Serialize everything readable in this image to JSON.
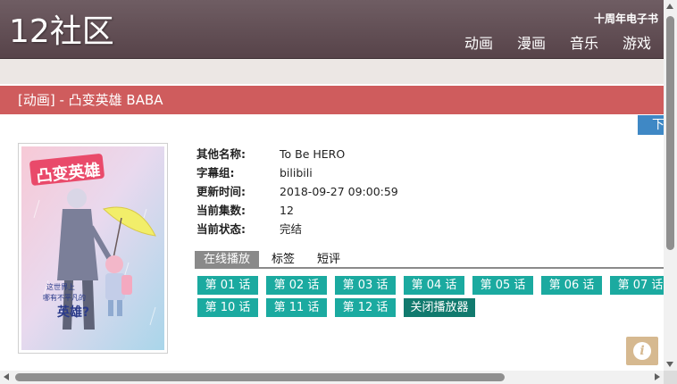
{
  "header": {
    "logo": "12社区",
    "anniversary_link": "十周年电子书",
    "nav": [
      "动画",
      "漫画",
      "音乐",
      "游戏"
    ]
  },
  "title_bar": {
    "title": "[动画] - 凸变英雄 BABA"
  },
  "download_button": "下",
  "poster": {
    "title_art": "凸变英雄",
    "caption_line1": "这世界上",
    "caption_line2": "哪有不平凡的",
    "caption_line3": "英雄?"
  },
  "info": [
    {
      "key": "其他名称:",
      "value": "To Be HERO"
    },
    {
      "key": "字幕组:",
      "value": "bilibili"
    },
    {
      "key": "更新时间:",
      "value": "2018-09-27 09:00:59"
    },
    {
      "key": "当前集数:",
      "value": "12"
    },
    {
      "key": "当前状态:",
      "value": "完结"
    }
  ],
  "tabs": [
    "在线播放",
    "标签",
    "短评"
  ],
  "active_tab": "在线播放",
  "episodes": [
    "第 01 话",
    "第 02 话",
    "第 03 话",
    "第 04 话",
    "第 05 话",
    "第 06 话",
    "第 07 话",
    "第 10 话",
    "第 11 话",
    "第 12 话"
  ],
  "close_player": "关闭播放器",
  "info_button_glyph": "i",
  "colors": {
    "header": "#5f4c52",
    "title_bar": "#cf5c5d",
    "episode_button": "#1baaa0",
    "close_button": "#117a6e",
    "download_button": "#3f88c5"
  }
}
